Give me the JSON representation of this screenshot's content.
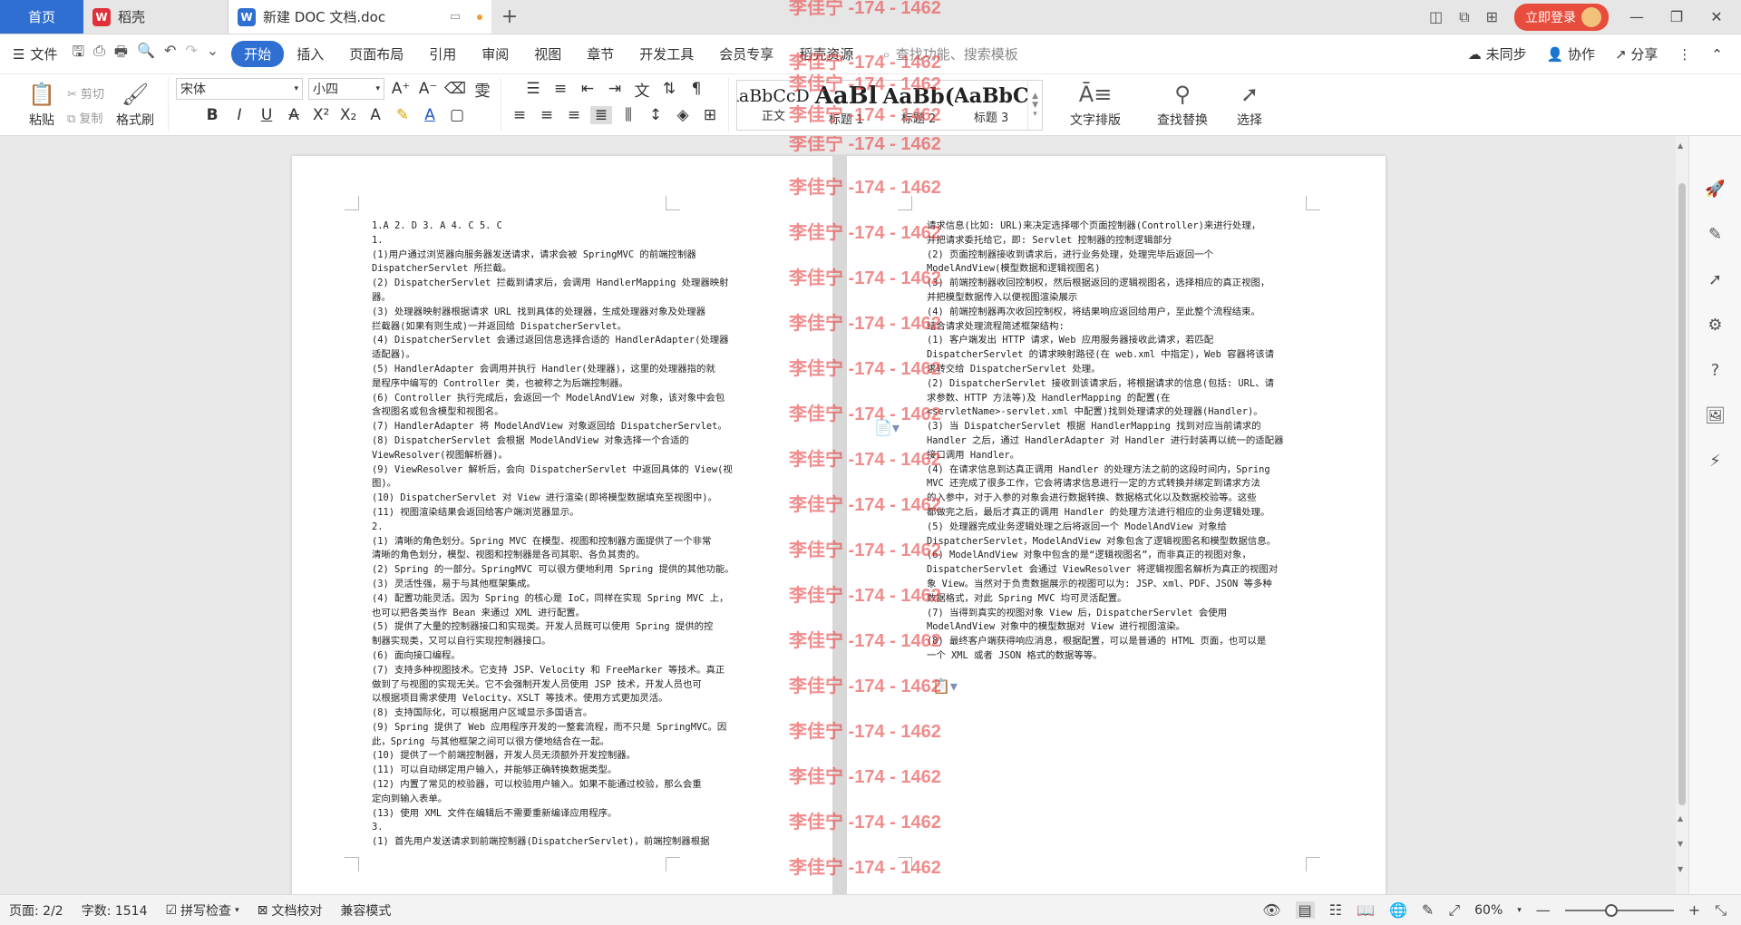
{
  "tabs": {
    "home": "首页",
    "wps": "稻壳",
    "doc": "新建 DOC 文档.doc",
    "login": "立即登录"
  },
  "menu": {
    "file": "文件",
    "items": [
      "开始",
      "插入",
      "页面布局",
      "引用",
      "审阅",
      "视图",
      "章节",
      "开发工具",
      "会员专享",
      "稻壳资源"
    ],
    "search": "查找功能、搜索模板",
    "unsynced": "未同步",
    "collab": "协作",
    "share": "分享"
  },
  "ribbon": {
    "paste": "粘贴",
    "cut": "剪切",
    "copy": "复制",
    "format_painter": "格式刷",
    "font_name": "宋体",
    "font_size": "小四",
    "styles": [
      {
        "sample": "AaBbCcDd",
        "name": "正文"
      },
      {
        "sample": "AaBl",
        "name": "标题 1"
      },
      {
        "sample": "AaBb(",
        "name": "标题 2"
      },
      {
        "sample": "AaBbC",
        "name": "标题 3"
      }
    ],
    "text_layout": "文字排版",
    "find_replace": "查找替换",
    "select": "选择"
  },
  "watermark": "李佳宁 -174 - 1462",
  "doc": {
    "left_lines": [
      "1.A 2. D 3. A 4. C 5. C",
      "1.",
      "(1)用户通过浏览器向服务器发送请求，请求会被 SpringMVC 的前端控制器",
      "DispatcherServlet 所拦截。",
      "(2) DispatcherServlet 拦截到请求后，会调用 HandlerMapping 处理器映射",
      "器。",
      "(3) 处理器映射器根据请求 URL 找到具体的处理器，生成处理器对象及处理器",
      "拦截器(如果有则生成)一并返回给 DispatcherServlet。",
      "(4) DispatcherServlet 会通过返回信息选择合适的 HandlerAdapter(处理器",
      "适配器)。",
      "(5) HandlerAdapter 会调用并执行 Handler(处理器)，这里的处理器指的就",
      "是程序中编写的 Controller 类，也被称之为后端控制器。",
      "(6) Controller 执行完成后，会返回一个 ModelAndView 对象，该对象中会包",
      "含视图名或包含模型和视图名。",
      "(7) HandlerAdapter 将 ModelAndView 对象返回给 DispatcherServlet。",
      "(8) DispatcherServlet 会根据 ModelAndView 对象选择一个合适的",
      "ViewResolver(视图解析器)。",
      "(9) ViewResolver 解析后，会向 DispatcherServlet 中返回具体的 View(视",
      "图)。",
      "(10) DispatcherServlet 对 View 进行渲染(即将模型数据填充至视图中)。",
      "(11) 视图渲染结果会返回给客户端浏览器显示。",
      "2.",
      "(1) 清晰的角色划分。Spring MVC 在模型、视图和控制器方面提供了一个非常",
      "清晰的角色划分，模型、视图和控制器是各司其职、各负其责的。",
      "(2) Spring 的一部分。SpringMVC 可以很方便地利用 Spring 提供的其他功能。",
      "(3) 灵活性强，易于与其他框架集成。",
      "(4) 配置功能灵活。因为 Spring 的核心是 IoC，同样在实现 Spring MVC 上，",
      "也可以把各类当作 Bean 来通过 XML 进行配置。",
      "(5) 提供了大量的控制器接口和实现类。开发人员既可以使用 Spring 提供的控",
      "制器实现类，又可以自行实现控制器接口。",
      "(6) 面向接口编程。",
      "(7) 支持多种视图技术。它支持 JSP、Velocity 和 FreeMarker 等技术。真正",
      "做到了与视图的实现无关。它不会强制开发人员使用 JSP 技术，开发人员也可",
      "以根据项目需求使用 Velocity、XSLT 等技术。使用方式更加灵活。",
      "(8) 支持国际化，可以根据用户区域显示多国语言。",
      "(9) Spring 提供了 Web 应用程序开发的一整套流程，而不只是 SpringMVC。因",
      "此，Spring 与其他框架之间可以很方便地结合在一起。",
      "(10) 提供了一个前端控制器，开发人员无须额外开发控制器。",
      "(11) 可以自动绑定用户输入，并能够正确转换数据类型。",
      "(12) 内置了常见的校验器，可以校验用户输入。如果不能通过校验，那么会重",
      "定向到输入表单。",
      "(13) 使用 XML 文件在编辑后不需要重新编译应用程序。",
      "3.",
      "(1) 首先用户发送请求到前端控制器(DispatcherServlet)，前端控制器根据"
    ],
    "right_lines": [
      "请求信息(比如: URL)来决定选择哪个页面控制器(Controller)来进行处理，",
      "并把请求委托给它，即: Servlet 控制器的控制逻辑部分",
      "(2) 页面控制器接收到请求后，进行业务处理，处理完毕后返回一个",
      "ModelAndView(模型数据和逻辑视图名)",
      "(3) 前端控制器收回控制权，然后根据返回的逻辑视图名，选择相应的真正视图，",
      "并把模型数据传入以便视图渲染展示",
      "(4) 前端控制器再次收回控制权，将结果响应返回给用户，至此整个流程结束。",
      "结合请求处理流程简述框架结构:",
      "(1) 客户端发出 HTTP 请求，Web 应用服务器接收此请求，若匹配",
      "DispatcherServlet 的请求映射路径(在 web.xml 中指定)，Web 容器将该请",
      "求转交给 DispatcherServlet 处理。",
      "(2) DispatcherServlet 接收到该请求后，将根据请求的信息(包括: URL、请",
      "求参数、HTTP 方法等)及 HandlerMapping 的配置(在",
      "<servletName>-servlet.xml 中配置)找到处理请求的处理器(Handler)。",
      "(3) 当 DispatcherServlet 根据 HandlerMapping 找到对应当前请求的",
      "Handler 之后，通过 HandlerAdapter 对 Handler 进行封装再以统一的适配器",
      "接口调用 Handler。",
      "(4) 在请求信息到达真正调用 Handler 的处理方法之前的这段时间内，Spring",
      "MVC 还完成了很多工作，它会将请求信息进行一定的方式转换并绑定到请求方法",
      "的入参中，对于入参的对象会进行数据转换、数据格式化以及数据校验等。这些",
      "都做完之后，最后才真正的调用 Handler 的处理方法进行相应的业务逻辑处理。",
      "(5) 处理器完成业务逻辑处理之后将返回一个 ModelAndView 对象给",
      "DispatcherServlet，ModelAndView 对象包含了逻辑视图名和模型数据信息。",
      "(6) ModelAndView 对象中包含的是“逻辑视图名”，而非真正的视图对象，",
      "DispatcherServlet 会通过 ViewResolver 将逻辑视图名解析为真正的视图对",
      "象 View。当然对于负责数据展示的视图可以为: JSP、xml、PDF、JSON 等多种",
      "数据格式，对此 Spring MVC 均可灵活配置。",
      "(7) 当得到真实的视图对象 View 后，DispatcherServlet 会使用",
      "ModelAndView 对象中的模型数据对 View 进行视图渲染。",
      "(8) 最终客户端获得响应消息，根据配置，可以是普通的 HTML 页面，也可以是",
      "一个 XML 或者 JSON 格式的数据等等。"
    ]
  },
  "status": {
    "page": "页面: 2/2",
    "words": "字数: 1514",
    "spell": "拼写检查",
    "proof": "文档校对",
    "compat": "兼容模式",
    "zoom": "60%"
  }
}
